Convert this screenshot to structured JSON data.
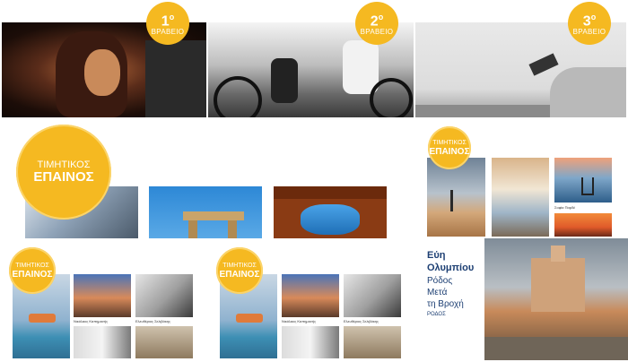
{
  "awards": [
    {
      "rank": "1",
      "suffix": "ο",
      "label": "ΒΡΑΒΕΙΟ"
    },
    {
      "rank": "2",
      "suffix": "ο",
      "label": "ΒΡΑΒΕΙΟ"
    },
    {
      "rank": "3",
      "suffix": "ο",
      "label": "ΒΡΑΒΕΙΟ"
    }
  ],
  "honorable": {
    "line1": "ΤΙΜΗΤΙΚΟΣ",
    "line2": "ΕΠΑΙΝΟΣ"
  },
  "captions": {
    "c1": "Νικόλαος Καπημανής",
    "c2": "Ελευθέριος Σελιβάκης",
    "c3": "Νικόλαος Καπημανής",
    "c4": "Ελευθέριος Σελιβάκης",
    "c5": "Σοφία Παρδέ"
  },
  "featured": {
    "name": "Εύη Ολυμπίου",
    "title_lines": [
      "Ρόδος",
      "Μετά",
      "τη Βροχή"
    ],
    "place": "ΡΟΔΟΣ"
  },
  "colors": {
    "badge": "#f5b921",
    "accent_text": "#1d3f73"
  }
}
